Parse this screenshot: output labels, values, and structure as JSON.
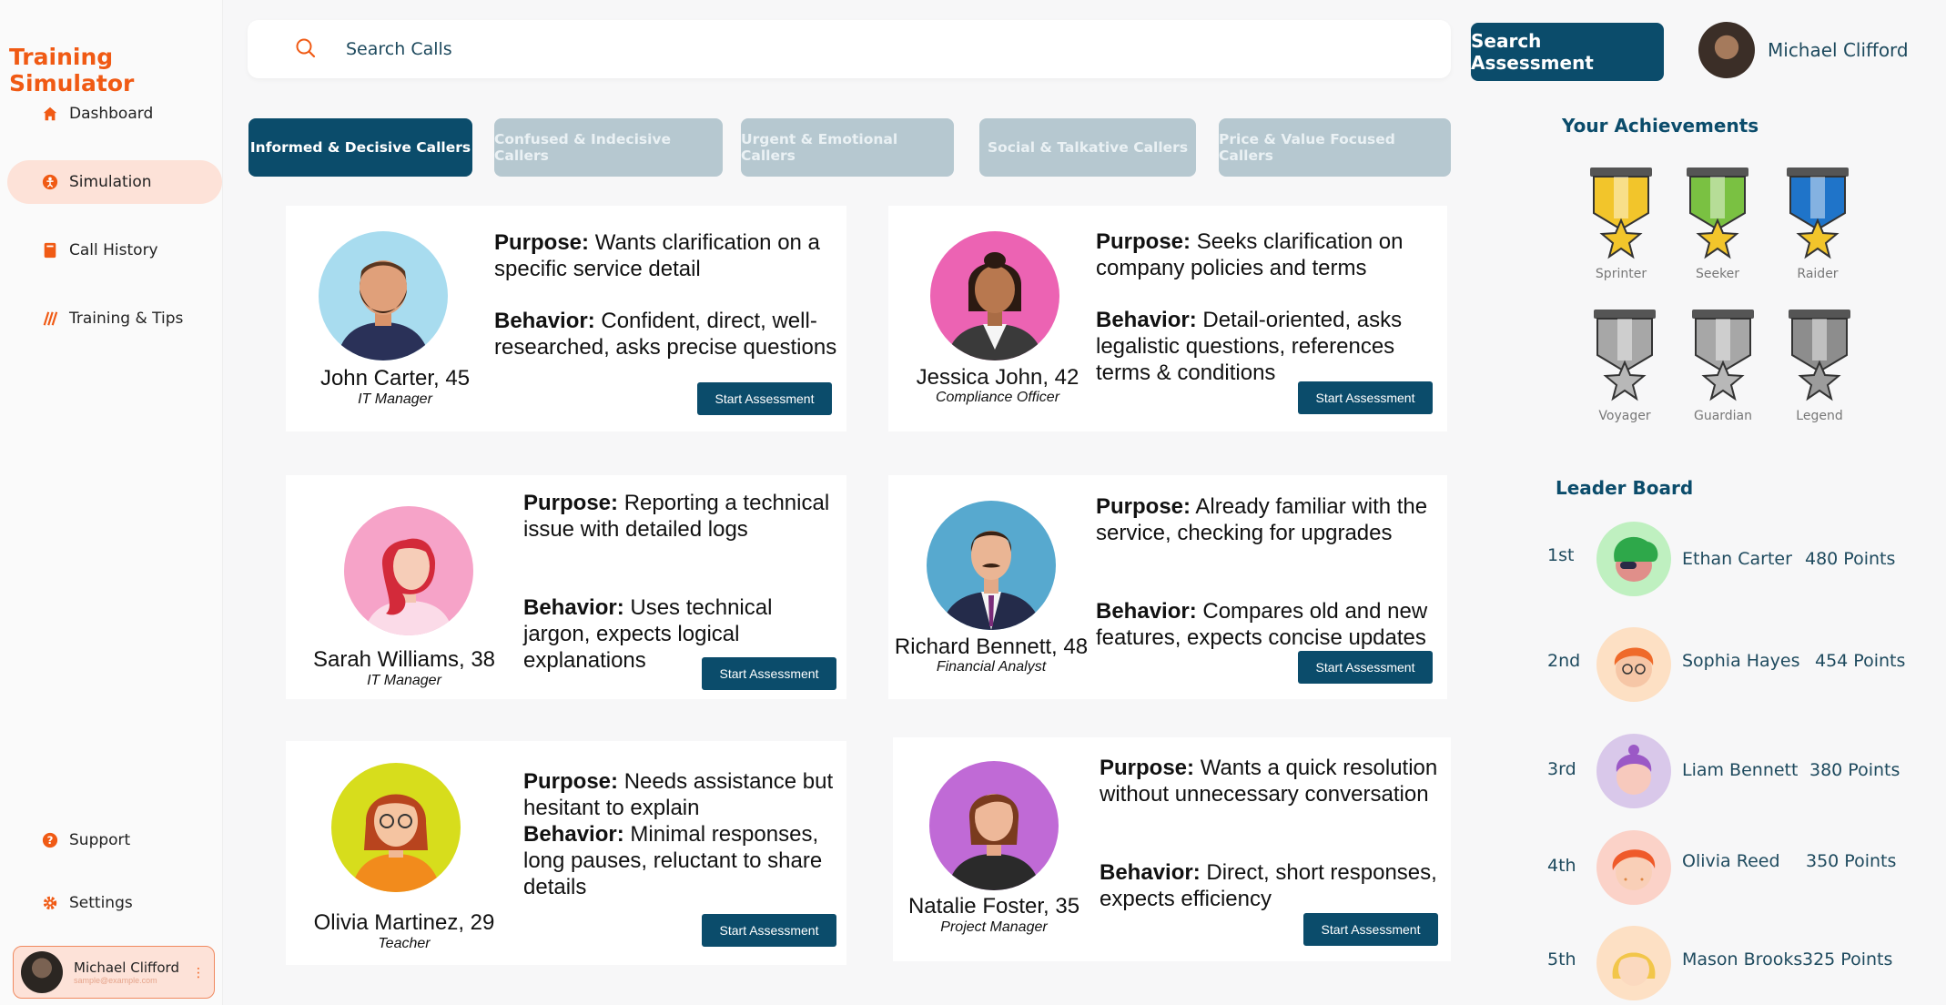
{
  "app": {
    "title": "Training Simulator"
  },
  "sidebar": {
    "items": [
      {
        "label": "Dashboard",
        "icon": "home-icon"
      },
      {
        "label": "Simulation",
        "icon": "simulation-icon",
        "active": true
      },
      {
        "label": "Call History",
        "icon": "book-icon"
      },
      {
        "label": "Training & Tips",
        "icon": "tips-icon"
      }
    ],
    "bottom_items": [
      {
        "label": "Support",
        "icon": "help-icon"
      },
      {
        "label": "Settings",
        "icon": "gear-icon"
      }
    ],
    "profile": {
      "name": "Michael Clifford",
      "email": "sample@example.com"
    }
  },
  "header": {
    "search_placeholder": "Search Calls",
    "search_button": "Search Assessment",
    "user_name": "Michael Clifford"
  },
  "tabs": [
    {
      "label": "Informed & Decisive Callers",
      "active": true
    },
    {
      "label": "Confused & Indecisive Callers",
      "active": false
    },
    {
      "label": "Urgent & Emotional Callers",
      "active": false
    },
    {
      "label": "Social & Talkative Callers",
      "active": false
    },
    {
      "label": "Price & Value Focused Callers",
      "active": false
    }
  ],
  "purpose_label": "Purpose:",
  "behavior_label": "Behavior:",
  "start_label": "Start Assessment",
  "callers": [
    {
      "name": "John Carter, 45",
      "role": "IT Manager",
      "purpose": "Wants clarification on a specific service detail",
      "behavior": "Confident, direct, well-researched, asks precise questions"
    },
    {
      "name": "Jessica John, 42",
      "role": "Compliance Officer",
      "purpose": "Seeks clarification on company policies and terms",
      "behavior": "Detail-oriented, asks legalistic questions, references terms & conditions"
    },
    {
      "name": "Sarah Williams, 38",
      "role": "IT Manager",
      "purpose": "Reporting a technical issue with detailed logs",
      "behavior": "Uses technical jargon, expects logical explanations"
    },
    {
      "name": "Richard Bennett, 48",
      "role": "Financial Analyst",
      "purpose": "Already familiar with the service, checking for upgrades",
      "behavior": "Compares old and new features, expects concise updates"
    },
    {
      "name": "Olivia Martinez, 29",
      "role": "Teacher",
      "purpose": "Needs assistance but hesitant to explain",
      "behavior": "Minimal responses, long pauses, reluctant to share details"
    },
    {
      "name": "Natalie Foster, 35",
      "role": "Project Manager",
      "purpose": "Wants a quick resolution without unnecessary conversation",
      "behavior": "Direct, short responses, expects efficiency"
    }
  ],
  "achievements": {
    "title": "Your Achievements",
    "badges": [
      {
        "label": "Sprinter",
        "ribbon": "#f2c52b",
        "star": "#f2c52b"
      },
      {
        "label": "Seeker",
        "ribbon": "#7ac142",
        "star": "#f2c52b"
      },
      {
        "label": "Raider",
        "ribbon": "#1f74c9",
        "star": "#f2c52b"
      },
      {
        "label": "Voyager",
        "ribbon": "#a7a7a7",
        "star": "#b8b8b8"
      },
      {
        "label": "Guardian",
        "ribbon": "#a7a7a7",
        "star": "#b8b8b8"
      },
      {
        "label": "Legend",
        "ribbon": "#8d8d8d",
        "star": "#9c9c9c"
      }
    ]
  },
  "leaderboard": {
    "title": "Leader Board",
    "entries": [
      {
        "rank": "1st",
        "name": "Ethan Carter",
        "points": "480 Points",
        "bg": "#bff0c0"
      },
      {
        "rank": "2nd",
        "name": "Sophia Hayes",
        "points": "454 Points",
        "bg": "#fde0c4"
      },
      {
        "rank": "3rd",
        "name": "Liam Bennett",
        "points": "380 Points",
        "bg": "#d9c8ea"
      },
      {
        "rank": "4th",
        "name": "Olivia Reed",
        "points": "350 Points",
        "bg": "#fbd2c8"
      },
      {
        "rank": "5th",
        "name": "Mason Brooks",
        "points": "325 Points",
        "bg": "#fde0c4"
      }
    ]
  },
  "colors": {
    "brand": "#f05a14",
    "primary": "#0b4c6b",
    "tab_inactive": "#b6c8d0",
    "active_nav": "#fde2d8"
  }
}
